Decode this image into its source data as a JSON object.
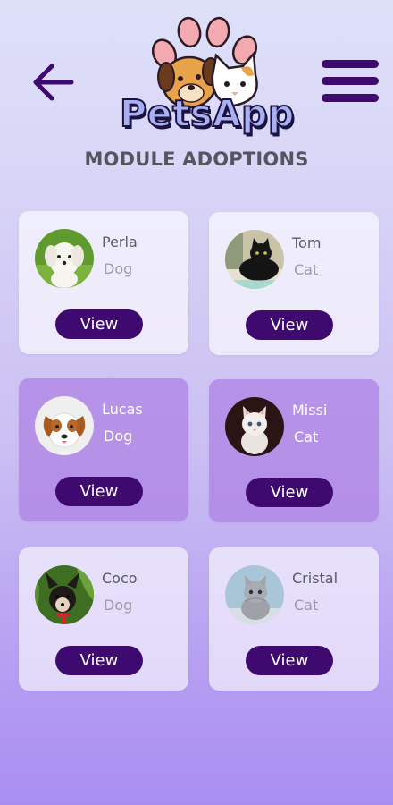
{
  "header": {
    "app_name": "PetsApp",
    "subtitle": "MODULE ADOPTIONS",
    "back_icon": "arrow-left-icon",
    "menu_icon": "hamburger-menu-icon",
    "accent_color": "#3e0a6f"
  },
  "pets": [
    {
      "name": "Perla",
      "type": "Dog",
      "button_label": "View",
      "highlighted": false
    },
    {
      "name": "Tom",
      "type": "Cat",
      "button_label": "View",
      "highlighted": false
    },
    {
      "name": "Lucas",
      "type": "Dog",
      "button_label": "View",
      "highlighted": true
    },
    {
      "name": "Missi",
      "type": "Cat",
      "button_label": "View",
      "highlighted": true
    },
    {
      "name": "Coco",
      "type": "Dog",
      "button_label": "View",
      "highlighted": false
    },
    {
      "name": "Cristal",
      "type": "Cat",
      "button_label": "View",
      "highlighted": false
    }
  ]
}
